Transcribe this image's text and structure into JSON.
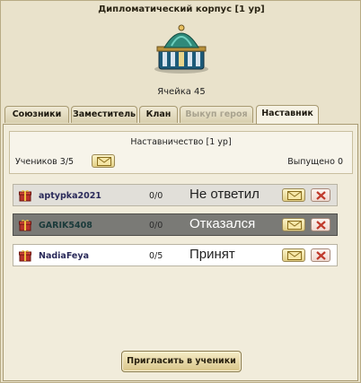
{
  "header": {
    "title": "Дипломатический корпус [1 ур]",
    "cell_label": "Ячейка 45"
  },
  "tabs": [
    {
      "label": "Союзники",
      "state": "normal"
    },
    {
      "label": "Заместитель",
      "state": "normal"
    },
    {
      "label": "Клан",
      "state": "normal"
    },
    {
      "label": "Выкуп героя",
      "state": "disabled"
    },
    {
      "label": "Наставник",
      "state": "active"
    }
  ],
  "mentorship": {
    "title": "Наставничество [1 ур]",
    "students_label": "Учеников 3/5",
    "released_label": "Выпущено 0"
  },
  "students": [
    {
      "name": "aptypka2021",
      "count": "0/0",
      "status": "Не ответил"
    },
    {
      "name": "GARIK5408",
      "count": "0/0",
      "status": "Отказался"
    },
    {
      "name": "NadiaFeya",
      "count": "0/5",
      "status": "Принят"
    }
  ],
  "actions": {
    "invite_label": "Пригласить в ученики"
  },
  "icons": {
    "envelope": "envelope-icon",
    "close": "close-icon",
    "gift": "gift-icon",
    "building": "embassy-building-icon"
  },
  "colors": {
    "panel_bg": "#f1ecdb",
    "highlight_row": "#7a7a76",
    "button_gold": "#e2cf86",
    "close_red": "#c0392b"
  }
}
